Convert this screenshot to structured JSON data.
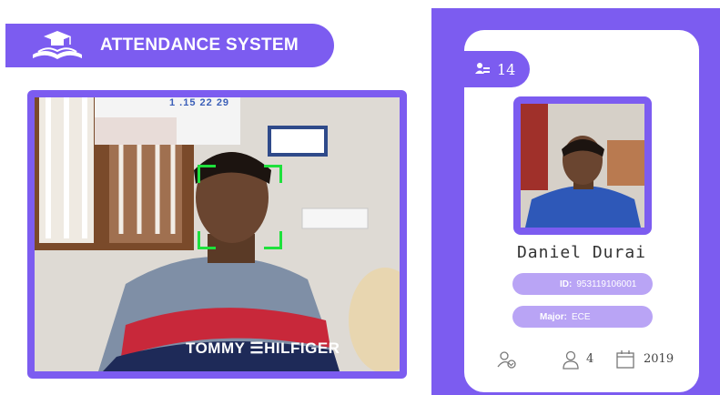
{
  "header": {
    "title": "ATTENDANCE SYSTEM",
    "logo_icon": "graduation-cap-book-icon"
  },
  "camera": {
    "calendar_text": "1 .15 22 29",
    "shirt_text": "TOMMY ☰HILFIGER",
    "detection_color": "#1ee13c"
  },
  "card": {
    "badge_icon": "user-count-icon",
    "badge_value": "14",
    "name": "Daniel Durai",
    "id_label": "ID:",
    "id_value": "953119106001",
    "major_label": "Major:",
    "major_value": "ECE",
    "footer": {
      "status_icon": "user-check-icon",
      "person_icon": "user-icon",
      "person_value": "4",
      "calendar_icon": "calendar-icon",
      "year_value": "2019"
    }
  },
  "colors": {
    "accent": "#7c5cf0",
    "pill": "#b9a4f5"
  }
}
